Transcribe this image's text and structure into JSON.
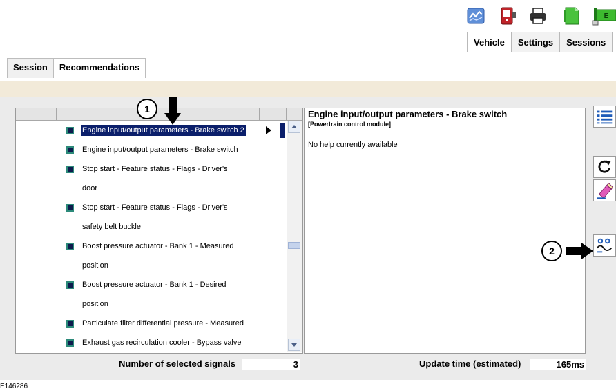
{
  "toolbar": {
    "icons": [
      "chart-icon",
      "red-module-icon",
      "printer-icon",
      "green-document-icon",
      "green-flag-icon"
    ]
  },
  "top_tabs": [
    {
      "label": "Vehicle",
      "active": true
    },
    {
      "label": "Settings",
      "active": false
    },
    {
      "label": "Sessions",
      "active": false
    }
  ],
  "sub_tabs": [
    {
      "label": "Session",
      "active": false
    },
    {
      "label": "Recommendations",
      "active": true
    }
  ],
  "signal_list": {
    "items": [
      {
        "text": "Engine input/output parameters - Brake switch 2",
        "selected": true,
        "bullet": true
      },
      {
        "text": "Engine input/output parameters - Brake switch",
        "bullet": true
      },
      {
        "text": "Stop start - Feature status - Flags - Driver's",
        "bullet": true
      },
      {
        "text": "door",
        "bullet": false
      },
      {
        "text": "Stop start - Feature status - Flags - Driver's",
        "bullet": true
      },
      {
        "text": "safety belt buckle",
        "bullet": false
      },
      {
        "text": "Boost pressure actuator - Bank 1 - Measured",
        "bullet": true
      },
      {
        "text": "position",
        "bullet": false
      },
      {
        "text": "Boost pressure actuator - Bank 1 - Desired",
        "bullet": true
      },
      {
        "text": "position",
        "bullet": false
      },
      {
        "text": "Particulate filter differential pressure - Measured",
        "bullet": true
      },
      {
        "text": "Exhaust gas recirculation cooler - Bypass valve",
        "bullet": true
      }
    ]
  },
  "help_panel": {
    "title": "Engine input/output parameters - Brake switch",
    "subtitle": "[Powertrain control module]",
    "text": "No help currently available"
  },
  "status": {
    "selected_label": "Number of selected signals",
    "selected_value": "3",
    "update_label": "Update time (estimated)",
    "update_value": "165ms"
  },
  "callouts": {
    "one": "1",
    "two": "2"
  },
  "figure_id": "E146286",
  "side_buttons": [
    "list-icon",
    "refresh-icon",
    "eraser-icon",
    "graph-view-icon"
  ],
  "colors": {
    "selection": "#0b1f6b",
    "beige_bar": "#f2ead9",
    "panel_bg": "#ebebeb"
  }
}
